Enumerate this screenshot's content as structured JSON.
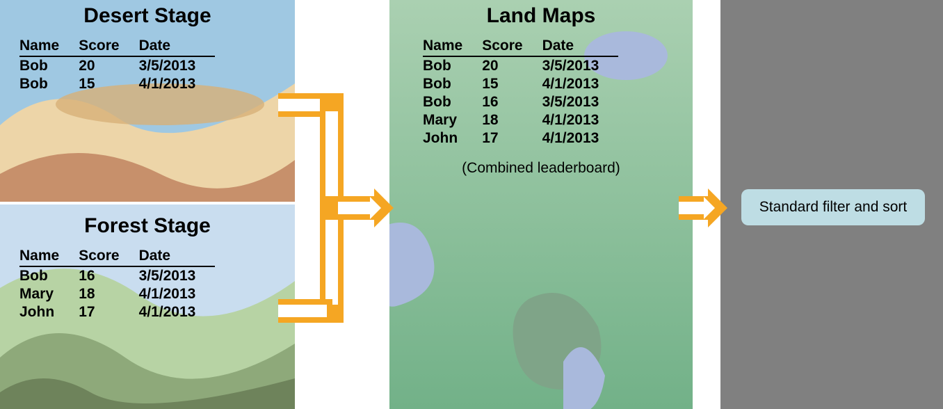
{
  "columns": {
    "name": "Name",
    "score": "Score",
    "date": "Date"
  },
  "desert": {
    "title": "Desert Stage",
    "rows": [
      {
        "name": "Bob",
        "score": 20,
        "date": "3/5/2013"
      },
      {
        "name": "Bob",
        "score": 15,
        "date": "4/1/2013"
      }
    ]
  },
  "forest": {
    "title": "Forest Stage",
    "rows": [
      {
        "name": "Bob",
        "score": 16,
        "date": "3/5/2013"
      },
      {
        "name": "Mary",
        "score": 18,
        "date": "4/1/2013"
      },
      {
        "name": "John",
        "score": 17,
        "date": "4/1/2013"
      }
    ]
  },
  "land": {
    "title": "Land Maps",
    "subtitle": "(Combined leaderboard)",
    "rows": [
      {
        "name": "Bob",
        "score": 20,
        "date": "3/5/2013"
      },
      {
        "name": "Bob",
        "score": 15,
        "date": "4/1/2013"
      },
      {
        "name": "Bob",
        "score": 16,
        "date": "3/5/2013"
      },
      {
        "name": "Mary",
        "score": 18,
        "date": "4/1/2013"
      },
      {
        "name": "John",
        "score": 17,
        "date": "4/1/2013"
      }
    ]
  },
  "output": {
    "label": "Standard filter and sort"
  }
}
